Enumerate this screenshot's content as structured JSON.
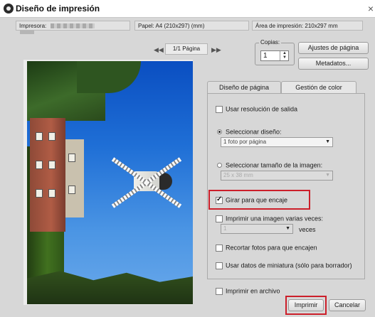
{
  "window": {
    "title": "Diseño de impresión",
    "close_glyph": "×"
  },
  "info": {
    "printer_label": "Impresora:",
    "paper": "Papel: A4 (210x297) (mm)",
    "print_area": "Área de impresión: 210x297 mm"
  },
  "pager": {
    "prev": "◀◀",
    "page": "1/1 Página",
    "next": "▶▶"
  },
  "copies": {
    "label": "Copias:",
    "value": "1",
    "up": "▲",
    "down": "▼"
  },
  "buttons": {
    "page_settings": "Ajustes de página",
    "metadata": "Metadatos...",
    "print": "Imprimir",
    "cancel": "Cancelar"
  },
  "tabs": [
    {
      "label": "Diseño de página",
      "active": true
    },
    {
      "label": "Gestión de color",
      "active": false
    }
  ],
  "options": {
    "use_output_resolution": {
      "label": "Usar resolución de salida",
      "checked": false
    },
    "select_layout": {
      "label": "Seleccionar diseño:",
      "selected": true,
      "dropdown_value": "1 foto por página"
    },
    "select_image_size": {
      "label": "Seleccionar tamaño de la imagen:",
      "selected": false,
      "dropdown_value": "25 x 38 mm"
    },
    "rotate_to_fit": {
      "label": "Girar para que encaje",
      "checked": true
    },
    "print_multiple": {
      "label": "Imprimir una imagen varias veces:",
      "checked": false,
      "dropdown_value": "1",
      "suffix": "veces"
    },
    "crop_to_fit": {
      "label": "Recortar fotos para que encajen",
      "checked": false
    },
    "thumbnail_data": {
      "label": "Usar datos de miniatura (sólo para borrador)",
      "checked": false
    },
    "print_to_file": {
      "label": "Imprimir en archivo",
      "checked": false
    }
  },
  "colors": {
    "highlight": "#cc1f2a",
    "background": "#d7d7d7"
  }
}
